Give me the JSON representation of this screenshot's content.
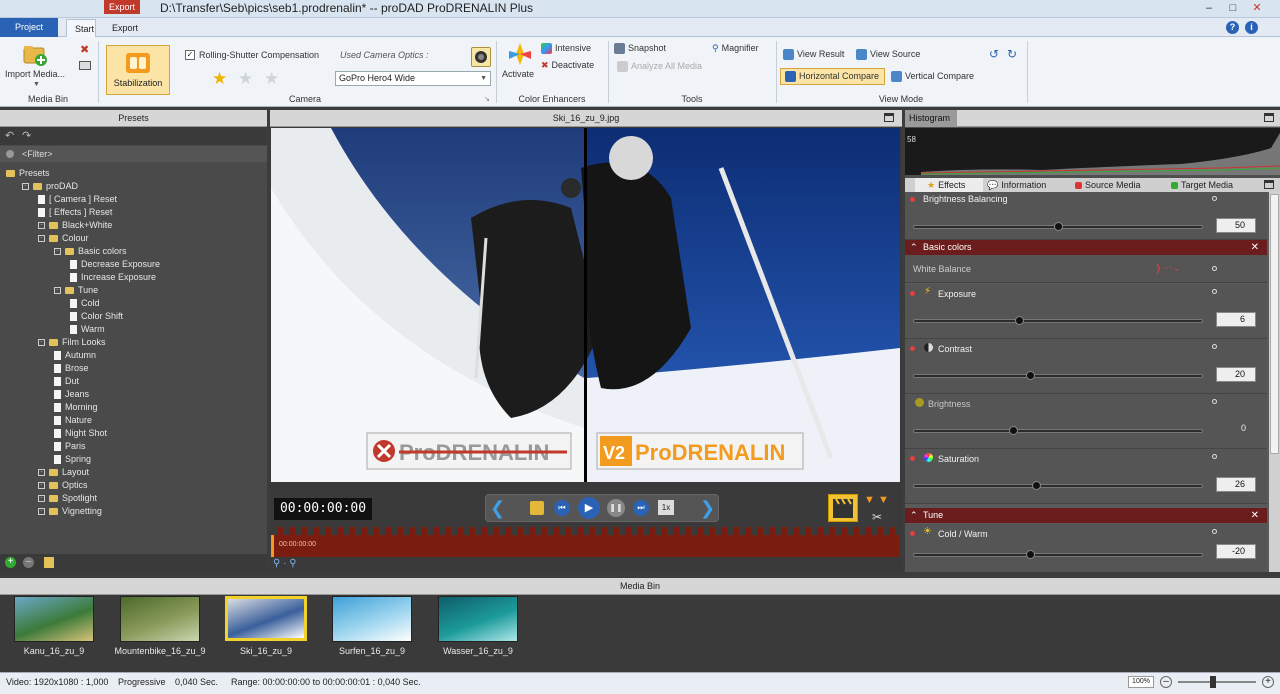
{
  "window": {
    "title": "D:\\Transfer\\Seb\\pics\\seb1.prodrenalin* -- proDAD ProDRENALIN Plus",
    "export_tab_top": "Export"
  },
  "ribbon_tabs": {
    "project": "Project",
    "start": "Start",
    "export": "Export"
  },
  "ribbon": {
    "media_bin": {
      "import_label": "Import Media...",
      "group": "Media Bin"
    },
    "camera": {
      "stabilization": "Stabilization",
      "rolling_shutter": "Rolling-Shutter Compensation",
      "used_optics": "Used Camera Optics :",
      "optics_value": "GoPro Hero4 Wide",
      "group": "Camera"
    },
    "color_enhancers": {
      "activate": "Activate",
      "intensive": "Intensive",
      "deactivate": "Deactivate",
      "group": "Color Enhancers"
    },
    "tools": {
      "snapshot": "Snapshot",
      "magnifier": "Magnifier",
      "analyze": "Analyze All Media",
      "group": "Tools"
    },
    "view_mode": {
      "view_result": "View Result",
      "view_source": "View Source",
      "horizontal": "Horizontal Compare",
      "vertical": "Vertical Compare",
      "group": "View Mode"
    }
  },
  "presets": {
    "header": "Presets",
    "filter": "<Filter>",
    "items": [
      {
        "label": "Presets",
        "level": 0,
        "kind": "folder"
      },
      {
        "label": "proDAD",
        "level": 1,
        "kind": "folder"
      },
      {
        "label": "[ Camera ]  Reset",
        "level": 2,
        "kind": "doc"
      },
      {
        "label": "[ Effects ]  Reset",
        "level": 2,
        "kind": "doc"
      },
      {
        "label": "Black+White",
        "level": 2,
        "kind": "folder"
      },
      {
        "label": "Colour",
        "level": 2,
        "kind": "folder"
      },
      {
        "label": "Basic colors",
        "level": 3,
        "kind": "folder"
      },
      {
        "label": "Decrease Exposure",
        "level": 4,
        "kind": "doc"
      },
      {
        "label": "Increase Exposure",
        "level": 4,
        "kind": "doc"
      },
      {
        "label": "Tune",
        "level": 3,
        "kind": "folder"
      },
      {
        "label": "Cold",
        "level": 4,
        "kind": "doc"
      },
      {
        "label": "Color Shift",
        "level": 4,
        "kind": "doc"
      },
      {
        "label": "Warm",
        "level": 4,
        "kind": "doc"
      },
      {
        "label": "Film Looks",
        "level": 2,
        "kind": "folder"
      },
      {
        "label": "Autumn",
        "level": 3,
        "kind": "doc"
      },
      {
        "label": "Brose",
        "level": 3,
        "kind": "doc"
      },
      {
        "label": "Dut",
        "level": 3,
        "kind": "doc"
      },
      {
        "label": "Jeans",
        "level": 3,
        "kind": "doc"
      },
      {
        "label": "Morning",
        "level": 3,
        "kind": "doc"
      },
      {
        "label": "Nature",
        "level": 3,
        "kind": "doc"
      },
      {
        "label": "Night Shot",
        "level": 3,
        "kind": "doc"
      },
      {
        "label": "Paris",
        "level": 3,
        "kind": "doc"
      },
      {
        "label": "Spring",
        "level": 3,
        "kind": "doc"
      },
      {
        "label": "Layout",
        "level": 2,
        "kind": "folder"
      },
      {
        "label": "Optics",
        "level": 2,
        "kind": "folder"
      },
      {
        "label": "Spotlight",
        "level": 2,
        "kind": "folder"
      },
      {
        "label": "Vignetting",
        "level": 2,
        "kind": "folder"
      }
    ]
  },
  "viewer": {
    "filename": "Ski_16_zu_9.jpg",
    "logo_old": "ProDRENALIN",
    "logo_new_v": "V2",
    "logo_new": "ProDRENALIN",
    "timecode": "00:00:00:00",
    "speed": "1x",
    "timeline_time": "00:00:00:00"
  },
  "right_panel": {
    "histogram_title": "Histogram",
    "histogram_value": "58",
    "tabs": [
      "Effects",
      "Information",
      "Source Media",
      "Target Media"
    ],
    "brightness_balancing": {
      "label": "Brightness Balancing",
      "value": "50",
      "level": 0.5
    },
    "basic_colors": "Basic colors",
    "white_balance": "White Balance",
    "exposure": {
      "label": "Exposure",
      "value": "6",
      "level": 0.36
    },
    "contrast": {
      "label": "Contrast",
      "value": "20",
      "level": 0.4
    },
    "brightness": {
      "label": "Brightness",
      "value": "0",
      "level": 0.34
    },
    "saturation": {
      "label": "Saturation",
      "value": "26",
      "level": 0.42
    },
    "tune": "Tune",
    "cold_warm": {
      "label": "Cold / Warm",
      "value": "-20",
      "level": 0.4
    }
  },
  "media_bin": {
    "header": "Media Bin",
    "items": [
      "Kanu_16_zu_9",
      "Mountenbike_16_zu_9",
      "Ski_16_zu_9",
      "Surfen_16_zu_9",
      "Wasser_16_zu_9"
    ],
    "selected": "Ski_16_zu_9"
  },
  "status": {
    "video": "Video: 1920x1080 : 1,000",
    "progressive": "Progressive",
    "duration": "0,040 Sec.",
    "range": "Range: 00:00:00:00 to 00:00:00:01 : 0,040 Sec.",
    "zoom": "100%"
  }
}
